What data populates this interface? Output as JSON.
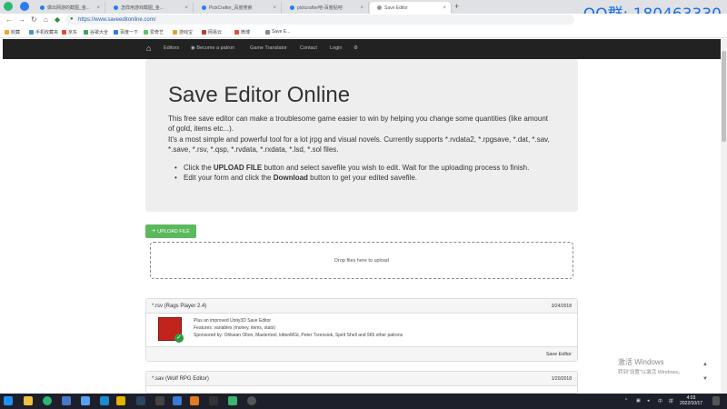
{
  "browser": {
    "tabs": [
      {
        "label": "做出网游的截图_金...",
        "active": false,
        "color": "#2b7de9"
      },
      {
        "label": "怎样用游戏截图_金...",
        "active": false,
        "color": "#2b7de9"
      },
      {
        "label": "PickCrafter_百度搜索",
        "active": false,
        "color": "#2b7de9"
      },
      {
        "label": "pickcrafter吧-百度贴吧",
        "active": false,
        "color": "#2b7de9"
      },
      {
        "label": "Save Editor",
        "active": true,
        "color": "#999999"
      }
    ],
    "close_glyph": "×",
    "new_tab_glyph": "+",
    "url": "https://www.saveeditonline.com/",
    "bookmarks": [
      "收藏",
      "手机收藏夹",
      "京东",
      "谷歌大全",
      "百度一下",
      "爱奇艺",
      "游戏宝",
      "网易云",
      "微博",
      "Save E..."
    ]
  },
  "overlay": {
    "qq_text": "QQ群: 180463330"
  },
  "site_nav": {
    "home_icon": "⌂",
    "items": [
      "Editors",
      "Become a patron",
      "Game Translator",
      "Contact",
      "Login",
      "⚙"
    ]
  },
  "hero": {
    "title": "Save Editor Online",
    "para1": "This free save editor can make a troublesome game easier to win by helping you change some quantities (like amount of gold, items etc...).",
    "para2": "It's a most simple and powerful tool for a lot jrpg and visual novels. Currently supports *.rvdata2, *.rpgsave, *.dat, *.sav, *.save, *.rsv, *.qsp, *.rvdata, *.rxdata, *.lsd, *.sol files.",
    "bullet1_a": "Click the ",
    "bullet1_b": "UPLOAD FILE",
    "bullet1_c": " button and select savefile you wish to edit. Wait for the uploading process to finish.",
    "bullet2_a": "Edit your form and click the ",
    "bullet2_b": "Download",
    "bullet2_c": " button to get your edited savefile."
  },
  "upload": {
    "button_label": "UPLOAD FILE",
    "dropzone_text": "Drop files here to upload"
  },
  "panels": [
    {
      "title": "*.rsv (Rags Player 2.4)",
      "date": "3/24/2018",
      "lines": [
        "Plus an improved Unity3D Save Editor",
        "Features: variables (money, items, stats)",
        "Sponsored by: Ohkwan Olton, Mastertool, kittenMGt, Peter Trzensiok, Spirit Shell and 965 other patrons"
      ],
      "footer": "Save Editor"
    },
    {
      "title": "*.sav (Wolf RPG Editor)",
      "date": "1/20/2018"
    }
  ],
  "watermark": {
    "line1": "激活 Windows",
    "line2": "转到“设置”以激活 Windows。"
  },
  "taskbar": {
    "time": "4:03",
    "date": "2022/10/17"
  }
}
